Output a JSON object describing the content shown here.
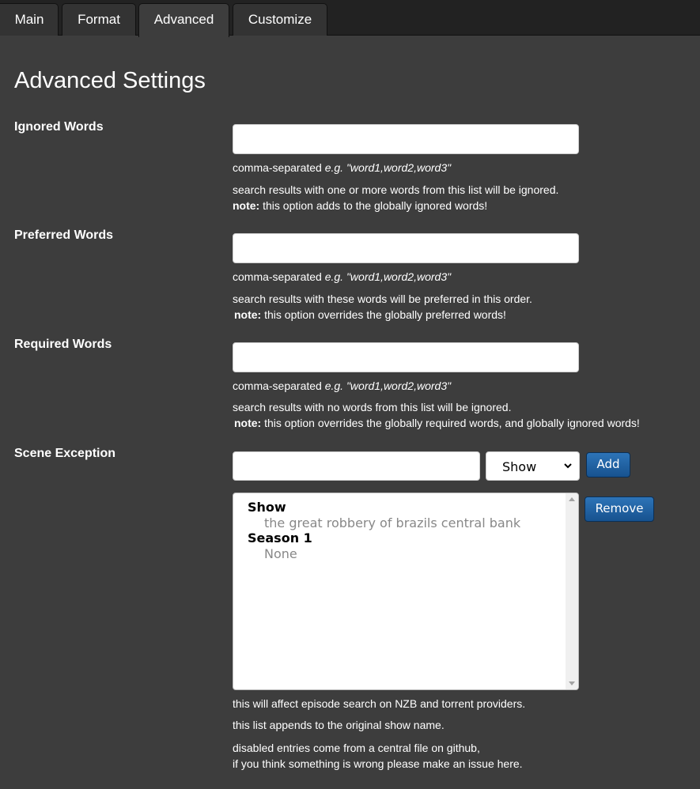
{
  "tabs": [
    {
      "label": "Main",
      "active": false
    },
    {
      "label": "Format",
      "active": false
    },
    {
      "label": "Advanced",
      "active": true
    },
    {
      "label": "Customize",
      "active": false
    }
  ],
  "page_title": "Advanced Settings",
  "ignored": {
    "label": "Ignored Words",
    "value": "",
    "hint_prefix": "comma-separated ",
    "hint_example": "e.g. \"word1,word2,word3\"",
    "desc": "search results with one or more words from this list will be ignored.",
    "note_label": "note:",
    "note_text": " this option adds to the globally ignored words!"
  },
  "preferred": {
    "label": "Preferred Words",
    "value": "",
    "hint_prefix": "comma-separated ",
    "hint_example": "e.g. \"word1,word2,word3\"",
    "desc": "search results with these words will be preferred in this order.",
    "note_label": "note:",
    "note_text": " this option overrides the globally preferred words!"
  },
  "required": {
    "label": "Required Words",
    "value": "",
    "hint_prefix": "comma-separated ",
    "hint_example": "e.g. \"word1,word2,word3\"",
    "desc": "search results with no words from this list will be ignored.",
    "note_label": "note:",
    "note_text": " this option overrides the globally required words, and globally ignored words!"
  },
  "scene_exception": {
    "label": "Scene Exception",
    "input_value": "",
    "select_value": "Show",
    "add_label": "Add",
    "remove_label": "Remove",
    "list": [
      {
        "group": "Show",
        "options": [
          "the great robbery of brazils central bank"
        ]
      },
      {
        "group": "Season 1",
        "options": [
          "None"
        ]
      }
    ],
    "notes": [
      "this will affect episode search on NZB and torrent providers.",
      "this list appends to the original show name.",
      "disabled entries come from a central file on github,",
      "if you think something is wrong please make an issue here."
    ]
  }
}
